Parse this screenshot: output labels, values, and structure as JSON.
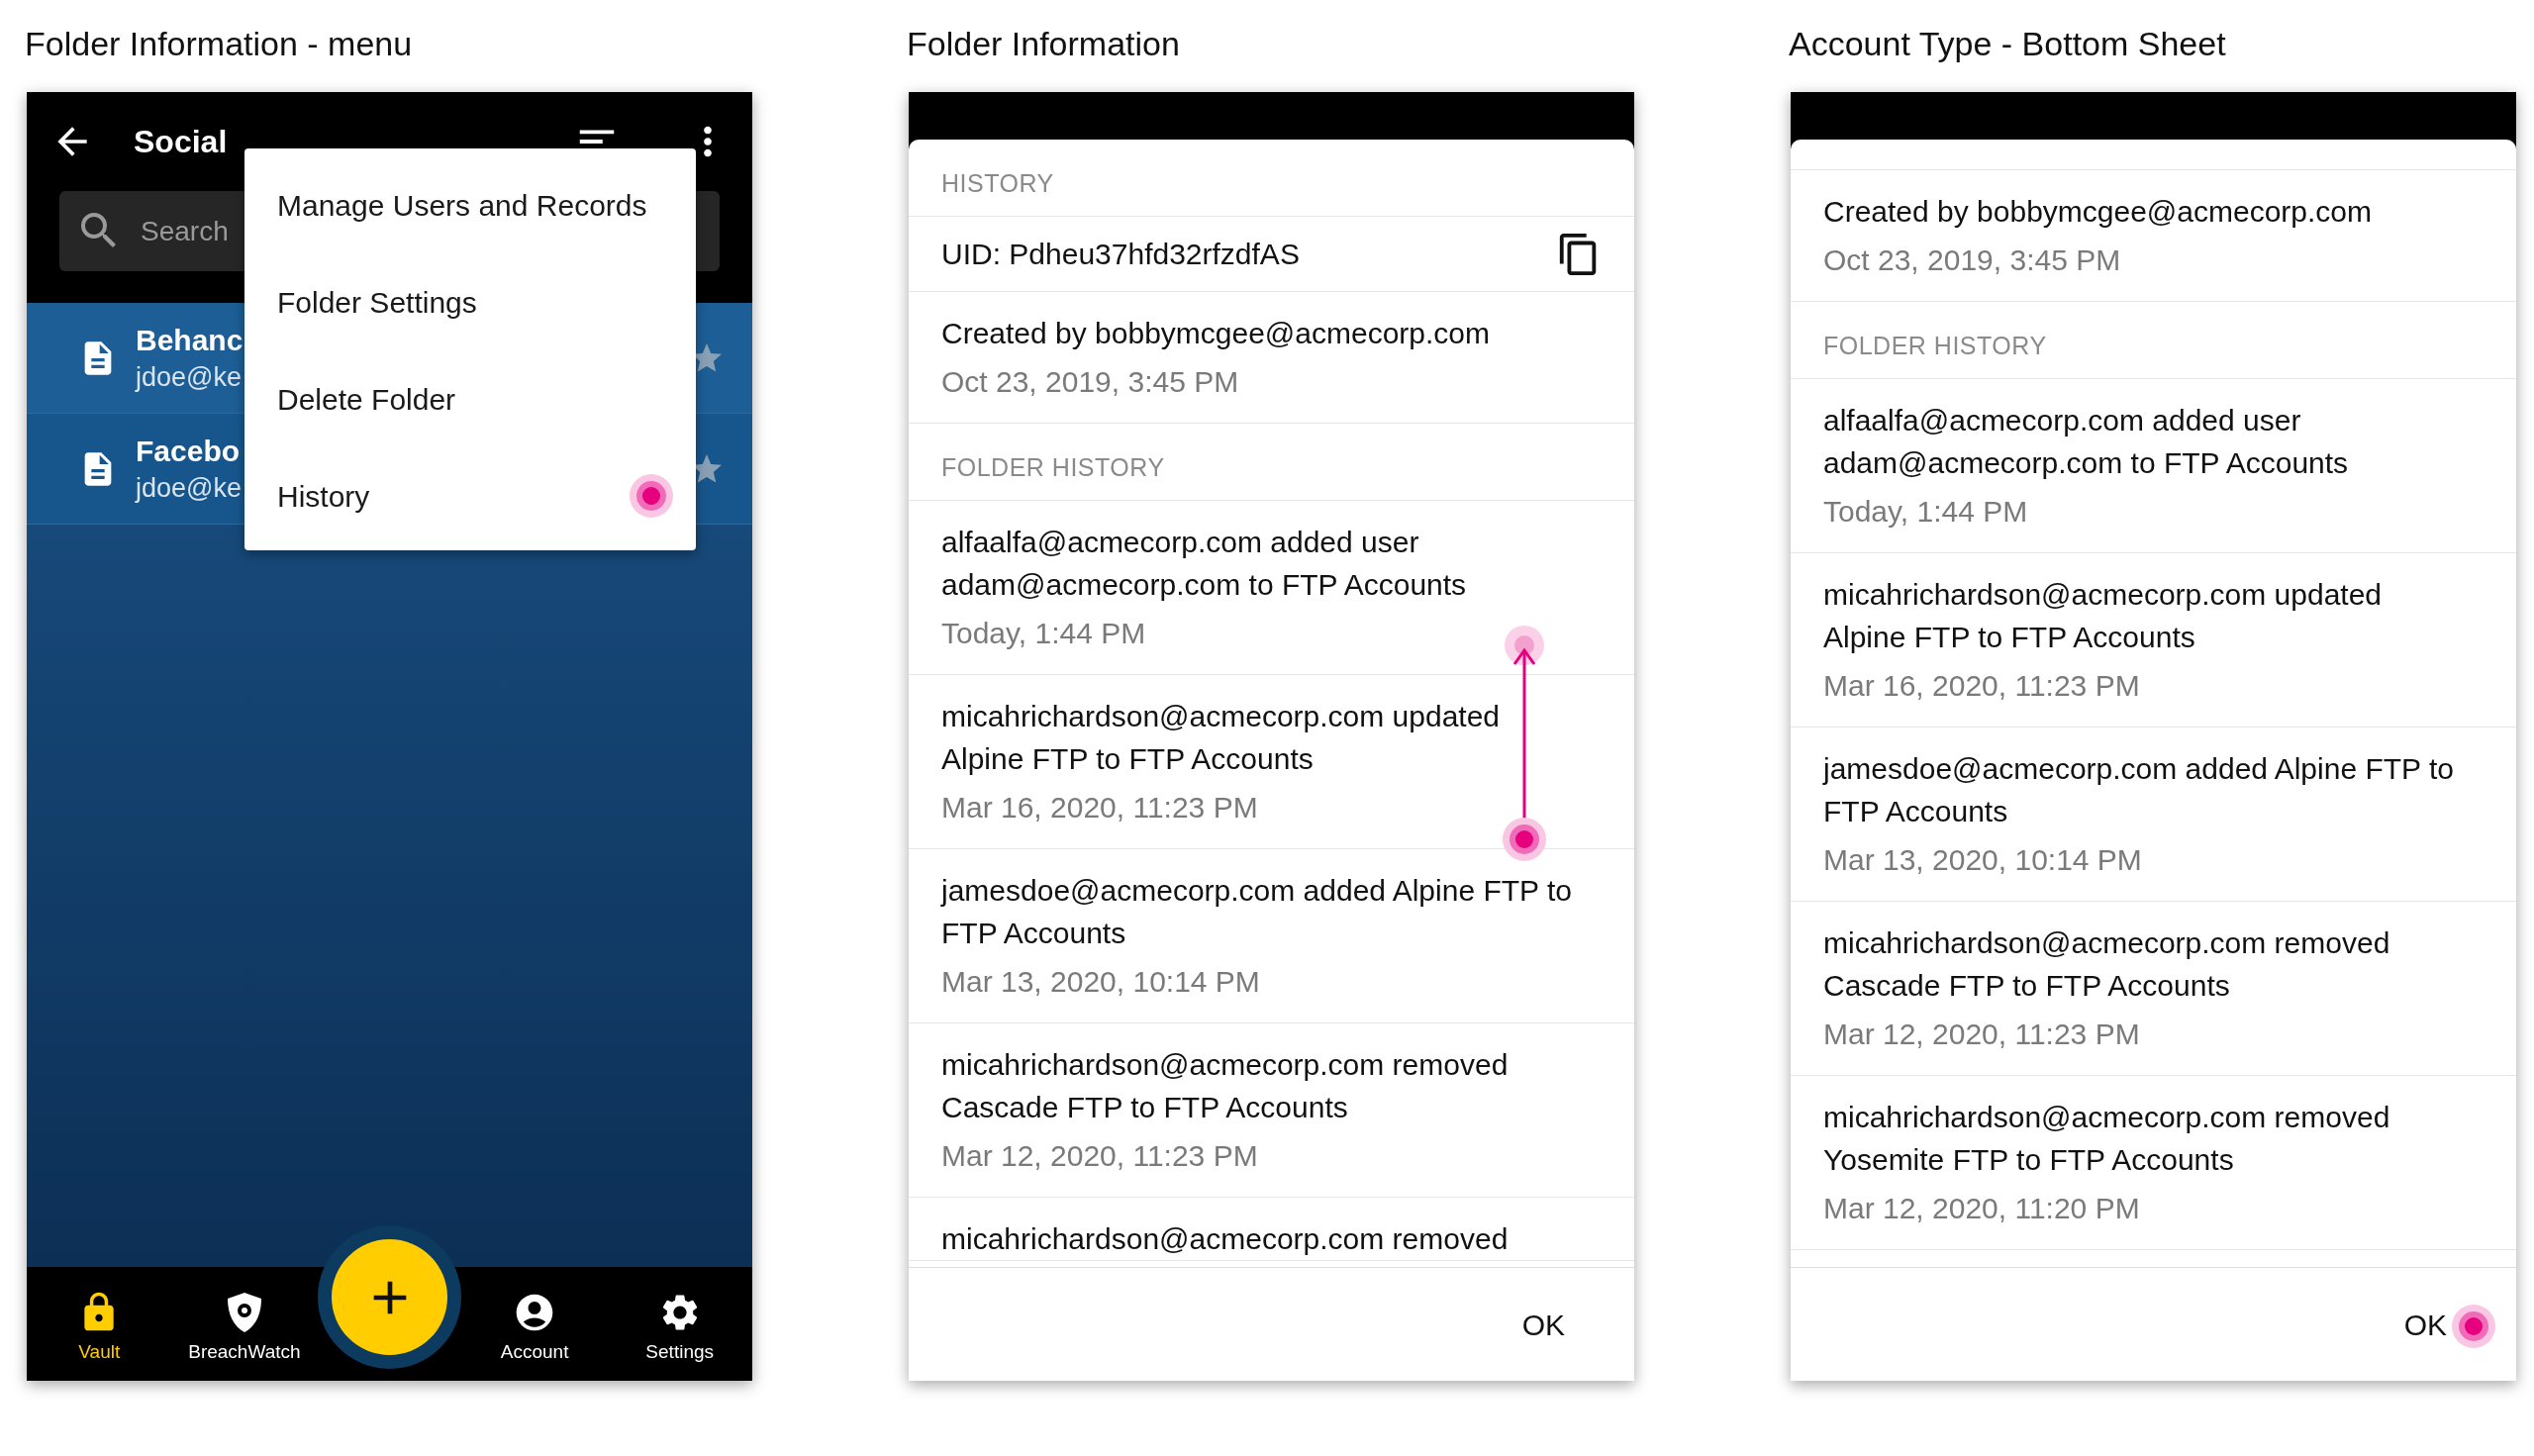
{
  "screens": [
    {
      "caption": "Folder Information - menu",
      "kind": "menu",
      "app_bar": {
        "title": "Social"
      },
      "search": {
        "placeholder": "Search"
      },
      "records": [
        {
          "title": "Behanc",
          "subtitle": "jdoe@ke"
        },
        {
          "title": "Facebo",
          "subtitle": "jdoe@ke"
        }
      ],
      "menu": [
        {
          "label": "Manage Users and Records",
          "tapped": false
        },
        {
          "label": "Folder Settings",
          "tapped": false
        },
        {
          "label": "Delete Folder",
          "tapped": false
        },
        {
          "label": "History",
          "tapped": true
        }
      ],
      "nav": [
        {
          "label": "Vault",
          "selected": true
        },
        {
          "label": "BreachWatch",
          "selected": false
        },
        {
          "label": "Account",
          "selected": false
        },
        {
          "label": "Settings",
          "selected": false
        }
      ]
    },
    {
      "caption": "Folder Information",
      "kind": "sheet",
      "swipe_gesture": true,
      "items": [
        {
          "kind": "heading",
          "text": "HISTORY"
        },
        {
          "kind": "uid",
          "text": "UID: Pdheu37hfd32rfzdfAS"
        },
        {
          "kind": "entry",
          "text": "Created by bobbymcgee@acmecorp.com",
          "date": "Oct 23, 2019, 3:45 PM"
        },
        {
          "kind": "heading",
          "text": "FOLDER HISTORY"
        },
        {
          "kind": "entry",
          "text": "alfaalfa@acmecorp.com added user adam@acmecorp.com to FTP Accounts",
          "date": "Today, 1:44 PM"
        },
        {
          "kind": "entry",
          "text": "micahrichardson@acmecorp.com updated Alpine FTP to FTP Accounts",
          "date": "Mar 16, 2020, 11:23 PM"
        },
        {
          "kind": "entry",
          "text": "jamesdoe@acmecorp.com added Alpine FTP to FTP Accounts",
          "date": "Mar 13, 2020, 10:14 PM"
        },
        {
          "kind": "entry",
          "text": "micahrichardson@acmecorp.com removed Cascade FTP to FTP Accounts",
          "date": "Mar 12, 2020, 11:23 PM"
        },
        {
          "kind": "entry",
          "text": "micahrichardson@acmecorp.com removed"
        }
      ],
      "button": {
        "label": "OK",
        "tapped": false
      }
    },
    {
      "caption": "Account Type - Bottom Sheet",
      "kind": "sheet",
      "items": [
        {
          "kind": "cut"
        },
        {
          "kind": "entry",
          "text": "Created by bobbymcgee@acmecorp.com",
          "date": "Oct 23, 2019, 3:45 PM"
        },
        {
          "kind": "heading",
          "text": "FOLDER HISTORY"
        },
        {
          "kind": "entry",
          "text": "alfaalfa@acmecorp.com added user adam@acmecorp.com to FTP Accounts",
          "date": "Today, 1:44 PM"
        },
        {
          "kind": "entry",
          "text": "micahrichardson@acmecorp.com updated Alpine FTP to FTP Accounts",
          "date": "Mar 16, 2020, 11:23 PM"
        },
        {
          "kind": "entry",
          "text": "jamesdoe@acmecorp.com added Alpine FTP to FTP Accounts",
          "date": "Mar 13, 2020, 10:14 PM"
        },
        {
          "kind": "entry",
          "text": "micahrichardson@acmecorp.com removed Cascade FTP to FTP Accounts",
          "date": "Mar 12, 2020, 11:23 PM"
        },
        {
          "kind": "entry",
          "text": "micahrichardson@acmecorp.com removed Yosemite FTP to FTP Accounts",
          "date": "Mar 12, 2020, 11:20 PM"
        }
      ],
      "button": {
        "label": "OK",
        "tapped": true
      }
    }
  ]
}
